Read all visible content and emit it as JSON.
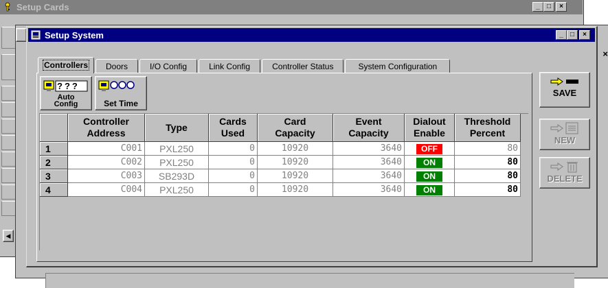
{
  "back_window": {
    "title": "Setup Cards"
  },
  "front_window": {
    "title": "Setup System"
  },
  "tabs": [
    {
      "label": "Controllers",
      "active": true
    },
    {
      "label": "Doors"
    },
    {
      "label": "I/O Config"
    },
    {
      "label": "Link Config"
    },
    {
      "label": "Controller Status"
    },
    {
      "label": "System Configuration"
    }
  ],
  "toolbar": {
    "auto_config_label": "Auto\nConfig",
    "auto_config_icon_text": "???",
    "set_time_label": "Set Time"
  },
  "grid": {
    "columns": [
      "Controller\nAddress",
      "Type",
      "Cards\nUsed",
      "Card\nCapacity",
      "Event\nCapacity",
      "Dialout\nEnable",
      "Threshold\nPercent"
    ],
    "rows": [
      {
        "num": "1",
        "address": "C001",
        "type": "PXL250",
        "cards_used": "0",
        "card_capacity": "10920",
        "event_capacity": "3640",
        "dialout": "OFF",
        "threshold": "80"
      },
      {
        "num": "2",
        "address": "C002",
        "type": "PXL250",
        "cards_used": "0",
        "card_capacity": "10920",
        "event_capacity": "3640",
        "dialout": "ON",
        "threshold": "80"
      },
      {
        "num": "3",
        "address": "C003",
        "type": "SB293D",
        "cards_used": "0",
        "card_capacity": "10920",
        "event_capacity": "3640",
        "dialout": "ON",
        "threshold": "80"
      },
      {
        "num": "4",
        "address": "C004",
        "type": "PXL250",
        "cards_used": "0",
        "card_capacity": "10920",
        "event_capacity": "3640",
        "dialout": "ON",
        "threshold": "80"
      }
    ]
  },
  "side_buttons": {
    "save_label": "SAVE",
    "new_label": "NEW",
    "delete_label": "DELETE"
  },
  "window_buttons": {
    "minimize": "_",
    "maximize": "□",
    "close": "×"
  },
  "colors": {
    "title_active": "#000080",
    "title_inactive": "#808080",
    "face": "#c0c0c0",
    "on_badge": "#008000",
    "off_badge": "#ff0000"
  }
}
